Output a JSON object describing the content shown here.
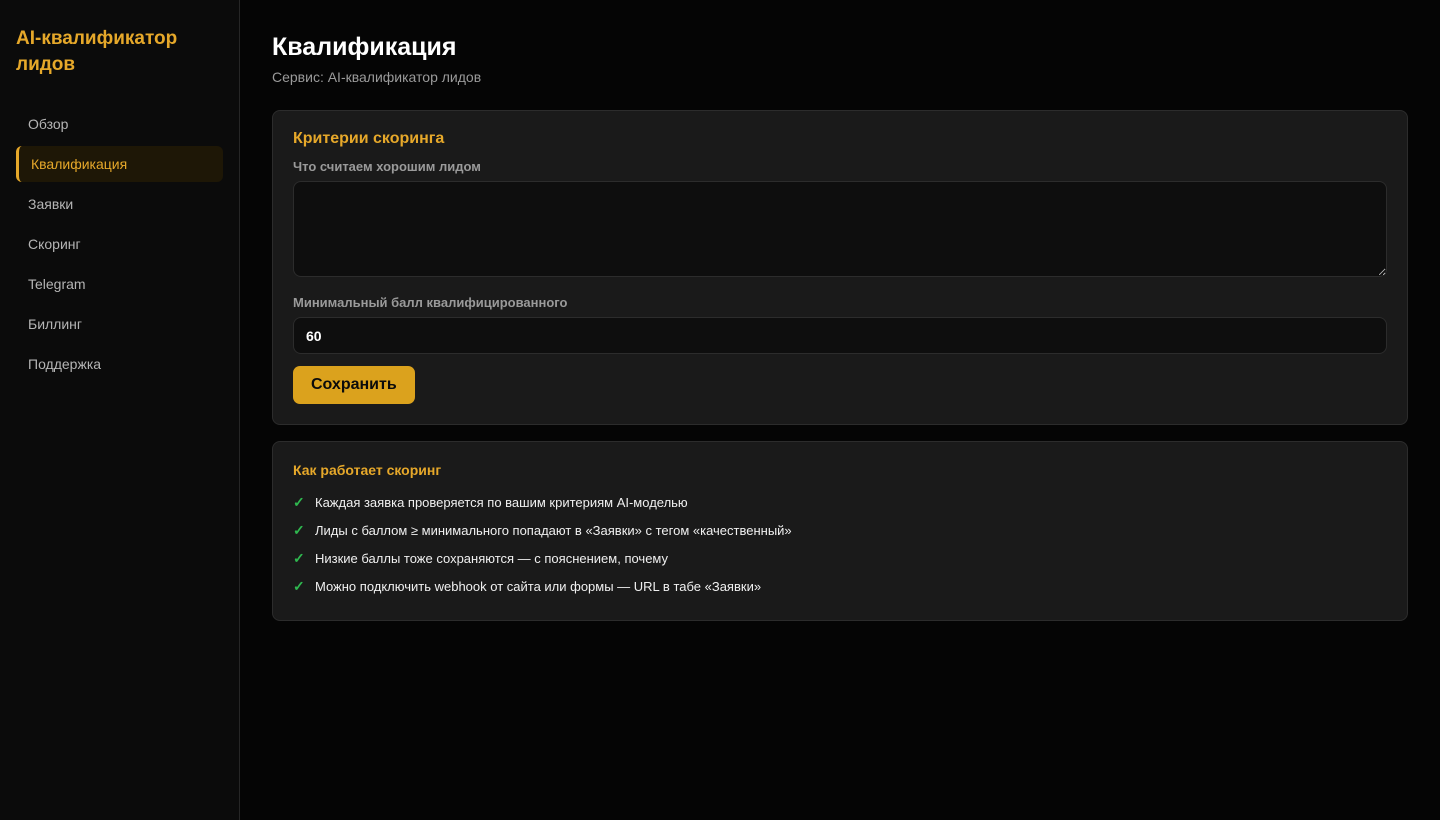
{
  "sidebar": {
    "brand": "AI-квалификатор лидов",
    "items": [
      {
        "label": "Обзор"
      },
      {
        "label": "Квалификация"
      },
      {
        "label": "Заявки"
      },
      {
        "label": "Скоринг"
      },
      {
        "label": "Telegram"
      },
      {
        "label": "Биллинг"
      },
      {
        "label": "Поддержка"
      }
    ],
    "active_index": 1
  },
  "header": {
    "title": "Квалификация",
    "subtitle": "Сервис: AI-квалификатор лидов"
  },
  "criteria_card": {
    "title": "Критерии скоринга",
    "good_lead_label": "Что считаем хорошим лидом",
    "good_lead_value": "",
    "min_score_label": "Минимальный балл квалифицированного",
    "min_score_value": "60",
    "save_label": "Сохранить"
  },
  "how_card": {
    "title": "Как работает скоринг",
    "check_icon": "check-icon",
    "items": [
      "Каждая заявка проверяется по вашим критериям AI-моделью",
      "Лиды с баллом ≥ минимального попадают в «Заявки» с тегом «качественный»",
      "Низкие баллы тоже сохраняются — с пояснением, почему",
      "Можно подключить webhook от сайта или формы — URL в табе «Заявки»"
    ]
  },
  "colors": {
    "accent": "#e6a82a",
    "button": "#dba21d",
    "check": "#2fb84f",
    "background": "#050505",
    "card": "#1a1a1a"
  }
}
